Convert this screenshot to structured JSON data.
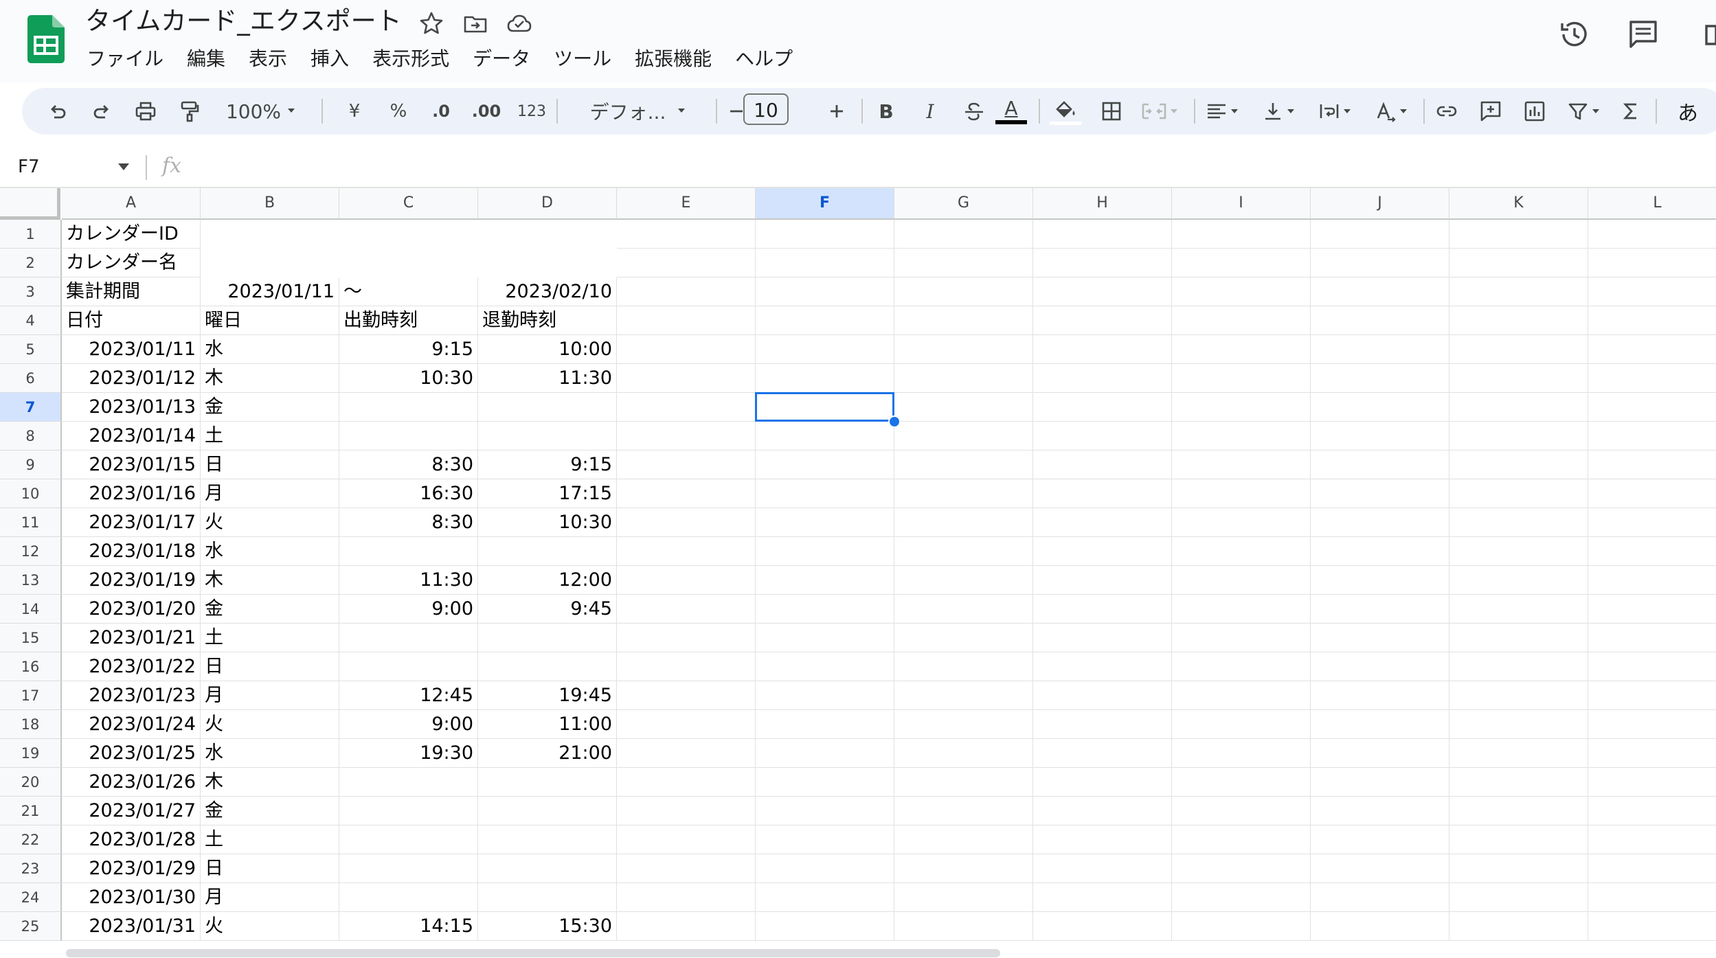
{
  "app": {
    "title": "タイムカード_エクスポート",
    "menu": [
      "ファイル",
      "編集",
      "表示",
      "挿入",
      "表示形式",
      "データ",
      "ツール",
      "拡張機能",
      "ヘルプ"
    ]
  },
  "toolbar": {
    "zoom": "100%",
    "currency": "¥",
    "percent": "%",
    "dec_decrease": ".0",
    "dec_increase": ".00",
    "number_format": "123",
    "font": "デフォ...",
    "font_size": "10",
    "bold": "B",
    "italic": "I",
    "text_color_letter": "A",
    "ime": "あ"
  },
  "formula_bar": {
    "cell_ref": "F7",
    "fx": "fx",
    "content": ""
  },
  "grid": {
    "columns": [
      "A",
      "B",
      "C",
      "D",
      "E",
      "F",
      "G",
      "H",
      "I",
      "J",
      "K",
      "L"
    ],
    "selected_column": "F",
    "selected_row": 7,
    "rows": [
      {
        "n": "1",
        "a": "カレンダーID",
        "b": "",
        "c": "",
        "d": ""
      },
      {
        "n": "2",
        "a": "カレンダー名",
        "b": "",
        "c": "",
        "d": ""
      },
      {
        "n": "3",
        "a": "集計期間",
        "b": "2023/01/11",
        "c": "〜",
        "d": "2023/02/10"
      },
      {
        "n": "4",
        "a": "日付",
        "b": "曜日",
        "c": "出勤時刻",
        "d": "退勤時刻"
      },
      {
        "n": "5",
        "a": "2023/01/11",
        "b": "水",
        "c": "9:15",
        "d": "10:00"
      },
      {
        "n": "6",
        "a": "2023/01/12",
        "b": "木",
        "c": "10:30",
        "d": "11:30"
      },
      {
        "n": "7",
        "a": "2023/01/13",
        "b": "金",
        "c": "",
        "d": ""
      },
      {
        "n": "8",
        "a": "2023/01/14",
        "b": "土",
        "c": "",
        "d": ""
      },
      {
        "n": "9",
        "a": "2023/01/15",
        "b": "日",
        "c": "8:30",
        "d": "9:15"
      },
      {
        "n": "10",
        "a": "2023/01/16",
        "b": "月",
        "c": "16:30",
        "d": "17:15"
      },
      {
        "n": "11",
        "a": "2023/01/17",
        "b": "火",
        "c": "8:30",
        "d": "10:30"
      },
      {
        "n": "12",
        "a": "2023/01/18",
        "b": "水",
        "c": "",
        "d": ""
      },
      {
        "n": "13",
        "a": "2023/01/19",
        "b": "木",
        "c": "11:30",
        "d": "12:00"
      },
      {
        "n": "14",
        "a": "2023/01/20",
        "b": "金",
        "c": "9:00",
        "d": "9:45"
      },
      {
        "n": "15",
        "a": "2023/01/21",
        "b": "土",
        "c": "",
        "d": ""
      },
      {
        "n": "16",
        "a": "2023/01/22",
        "b": "日",
        "c": "",
        "d": ""
      },
      {
        "n": "17",
        "a": "2023/01/23",
        "b": "月",
        "c": "12:45",
        "d": "19:45"
      },
      {
        "n": "18",
        "a": "2023/01/24",
        "b": "火",
        "c": "9:00",
        "d": "11:00"
      },
      {
        "n": "19",
        "a": "2023/01/25",
        "b": "水",
        "c": "19:30",
        "d": "21:00"
      },
      {
        "n": "20",
        "a": "2023/01/26",
        "b": "木",
        "c": "",
        "d": ""
      },
      {
        "n": "21",
        "a": "2023/01/27",
        "b": "金",
        "c": "",
        "d": ""
      },
      {
        "n": "22",
        "a": "2023/01/28",
        "b": "土",
        "c": "",
        "d": ""
      },
      {
        "n": "23",
        "a": "2023/01/29",
        "b": "日",
        "c": "",
        "d": ""
      },
      {
        "n": "24",
        "a": "2023/01/30",
        "b": "月",
        "c": "",
        "d": ""
      },
      {
        "n": "25",
        "a": "2023/01/31",
        "b": "火",
        "c": "14:15",
        "d": "15:30"
      }
    ]
  },
  "colors": {
    "accent": "#1a73e8",
    "header_selected": "#d3e3fd",
    "sheets_green": "#0f9d58"
  }
}
